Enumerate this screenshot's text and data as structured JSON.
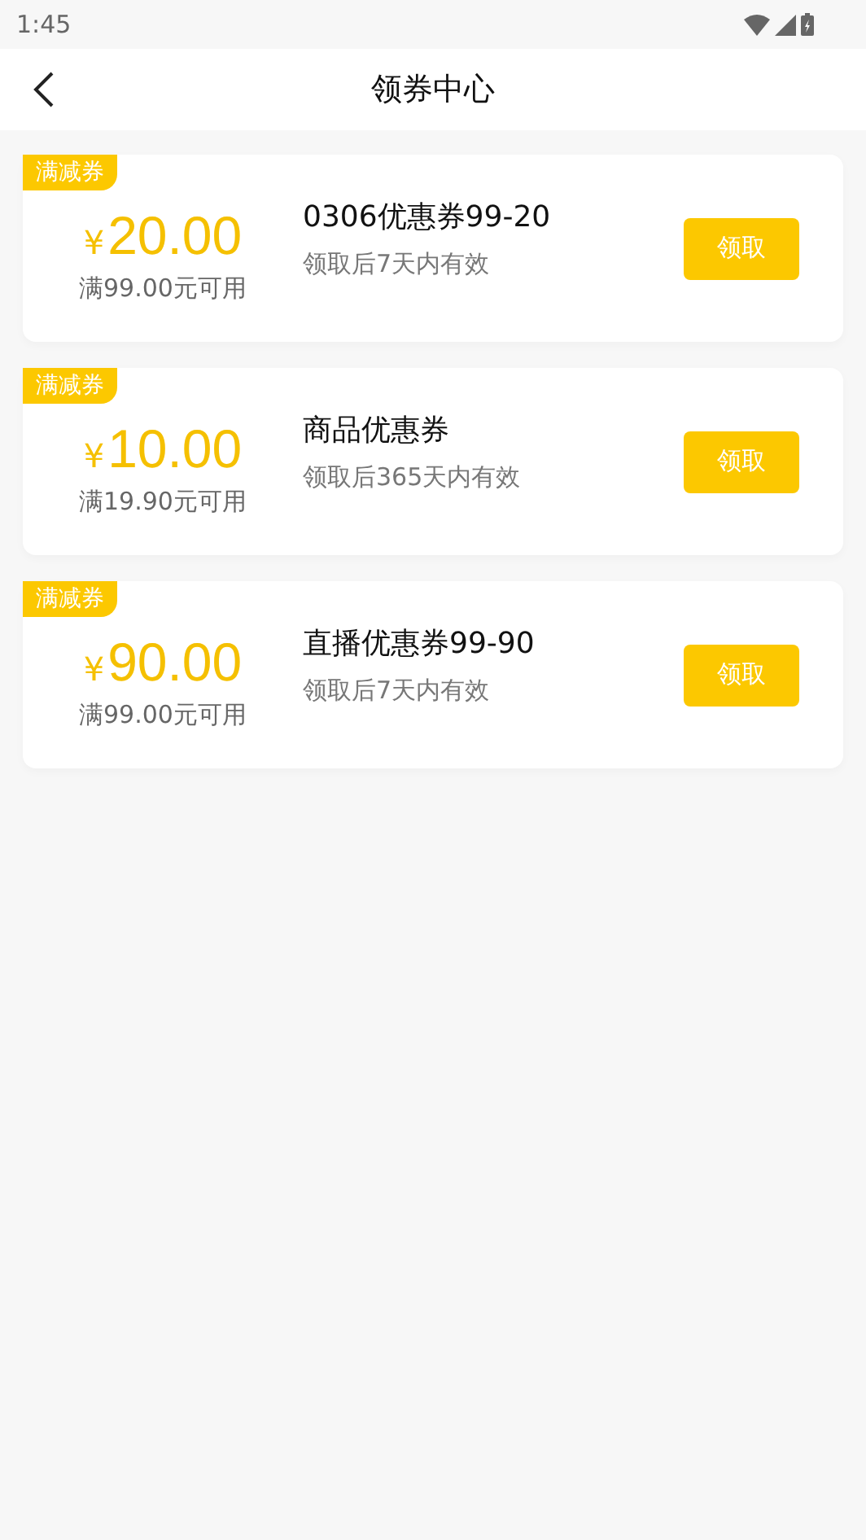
{
  "status_bar": {
    "time": "1:45"
  },
  "header": {
    "title": "领券中心"
  },
  "coupons": [
    {
      "tag": "满减券",
      "currency": "¥",
      "amount": "20.00",
      "condition": "满99.00元可用",
      "name": "0306优惠券99-20",
      "validity": "领取后7天内有效",
      "button": "领取"
    },
    {
      "tag": "满减券",
      "currency": "¥",
      "amount": "10.00",
      "condition": "满19.90元可用",
      "name": "商品优惠券",
      "validity": "领取后365天内有效",
      "button": "领取"
    },
    {
      "tag": "满减券",
      "currency": "¥",
      "amount": "90.00",
      "condition": "满99.00元可用",
      "name": "直播优惠券99-90",
      "validity": "领取后7天内有效",
      "button": "领取"
    }
  ]
}
